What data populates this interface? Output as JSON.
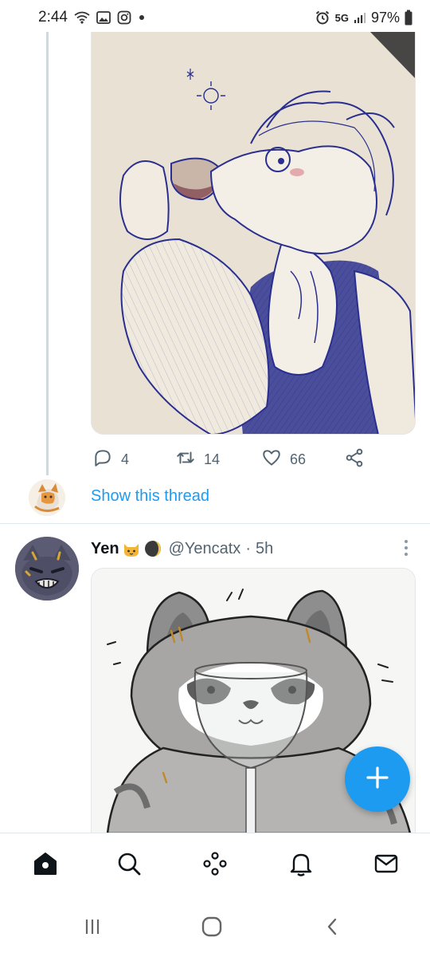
{
  "status_bar": {
    "time": "2:44",
    "network": "5G",
    "battery": "97%"
  },
  "tweet1": {
    "reply_count": "4",
    "retweet_count": "14",
    "like_count": "66",
    "show_thread_label": "Show this thread"
  },
  "tweet2": {
    "name": "Yen",
    "handle": "@Yencatx",
    "separator": "·",
    "time": "5h"
  },
  "nav": {
    "items": [
      "home-icon",
      "search-icon",
      "spaces-icon",
      "notifications-icon",
      "messages-icon"
    ]
  },
  "colors": {
    "accent": "#1d9bf0",
    "muted": "#536471",
    "divider": "#e1e8ed",
    "ink_blue": "#2a2f8f"
  }
}
